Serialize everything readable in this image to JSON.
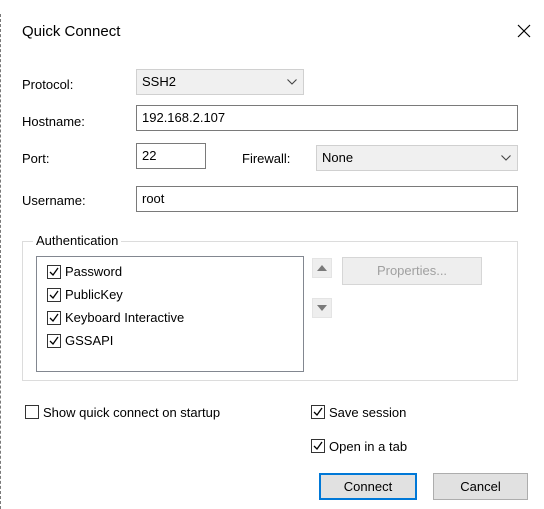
{
  "window": {
    "title": "Quick Connect"
  },
  "form": {
    "protocol_label": "Protocol:",
    "protocol_value": "SSH2",
    "hostname_label": "Hostname:",
    "hostname_value": "192.168.2.107",
    "port_label": "Port:",
    "port_value": "22",
    "firewall_label": "Firewall:",
    "firewall_value": "None",
    "username_label": "Username:",
    "username_value": "root"
  },
  "auth": {
    "group_title": "Authentication",
    "methods": [
      {
        "label": "Password",
        "checked": true
      },
      {
        "label": "PublicKey",
        "checked": true
      },
      {
        "label": "Keyboard Interactive",
        "checked": true
      },
      {
        "label": "GSSAPI",
        "checked": true
      }
    ],
    "properties_label": "Properties..."
  },
  "options": {
    "show_on_startup_label": "Show quick connect on startup",
    "show_on_startup_checked": false,
    "save_session_label": "Save session",
    "save_session_checked": true,
    "open_in_tab_label": "Open in a tab",
    "open_in_tab_checked": true
  },
  "buttons": {
    "connect_label": "Connect",
    "cancel_label": "Cancel"
  },
  "colors": {
    "accent": "#0078d7",
    "field_border": "#7a7a7a",
    "select_bg": "#f0f0f0"
  }
}
